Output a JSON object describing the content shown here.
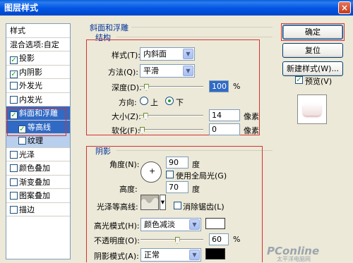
{
  "window": {
    "title": "图层样式",
    "close_glyph": "×"
  },
  "styles_list": {
    "header": "样式",
    "blend_options": "混合选项:自定",
    "items": [
      {
        "label": "投影",
        "checked": true
      },
      {
        "label": "内阴影",
        "checked": true
      },
      {
        "label": "外发光",
        "checked": false
      },
      {
        "label": "内发光",
        "checked": false
      },
      {
        "label": "斜面和浮雕",
        "checked": true,
        "selected": true
      },
      {
        "label": "等高线",
        "checked": true,
        "sub": true
      },
      {
        "label": "纹理",
        "checked": false,
        "sub": true
      },
      {
        "label": "光泽",
        "checked": false
      },
      {
        "label": "颜色叠加",
        "checked": false
      },
      {
        "label": "渐变叠加",
        "checked": false
      },
      {
        "label": "图案叠加",
        "checked": false
      },
      {
        "label": "描边",
        "checked": false
      }
    ]
  },
  "bevel": {
    "section_title": "斜面和浮雕",
    "structure_title": "结构",
    "style_label": "样式(T):",
    "style_value": "内斜面",
    "method_label": "方法(Q):",
    "method_value": "平滑",
    "depth_label": "深度(D):",
    "depth_value": "100",
    "depth_level": 100,
    "depth_unit": "%",
    "direction_label": "方向:",
    "direction_up": "上",
    "direction_down": "下",
    "direction_selected": "下",
    "size_label": "大小(Z):",
    "size_value": "14",
    "size_level": 14,
    "size_unit": "像素",
    "soften_label": "软化(F):",
    "soften_value": "0",
    "soften_level": 0,
    "soften_unit": "像素"
  },
  "shading": {
    "title": "阴影",
    "angle_label": "角度(N):",
    "angle_value": "90",
    "angle_unit": "度",
    "global_light_label": "使用全局光(G)",
    "altitude_label": "高度:",
    "altitude_value": "70",
    "altitude_unit": "度",
    "gloss_contour_label": "光泽等高线:",
    "antialias_label": "消除锯齿(L)",
    "highlight_mode_label": "高光模式(H):",
    "highlight_mode_value": "颜色减淡",
    "highlight_color": "#ffffff",
    "opacity_label": "不透明度(O):",
    "opacity_value": "60",
    "opacity_level": 60,
    "opacity_unit": "%",
    "shadow_mode_label": "阴影模式(A):",
    "shadow_mode_value": "正常",
    "shadow_color": "#000000"
  },
  "buttons": {
    "ok": "确定",
    "reset": "复位",
    "new_style": "新建样式(W)...",
    "preview_label": "预览(V)",
    "preview_checked": true
  },
  "watermark": {
    "brand": "PConline",
    "sub": "太平洋电脑网"
  }
}
